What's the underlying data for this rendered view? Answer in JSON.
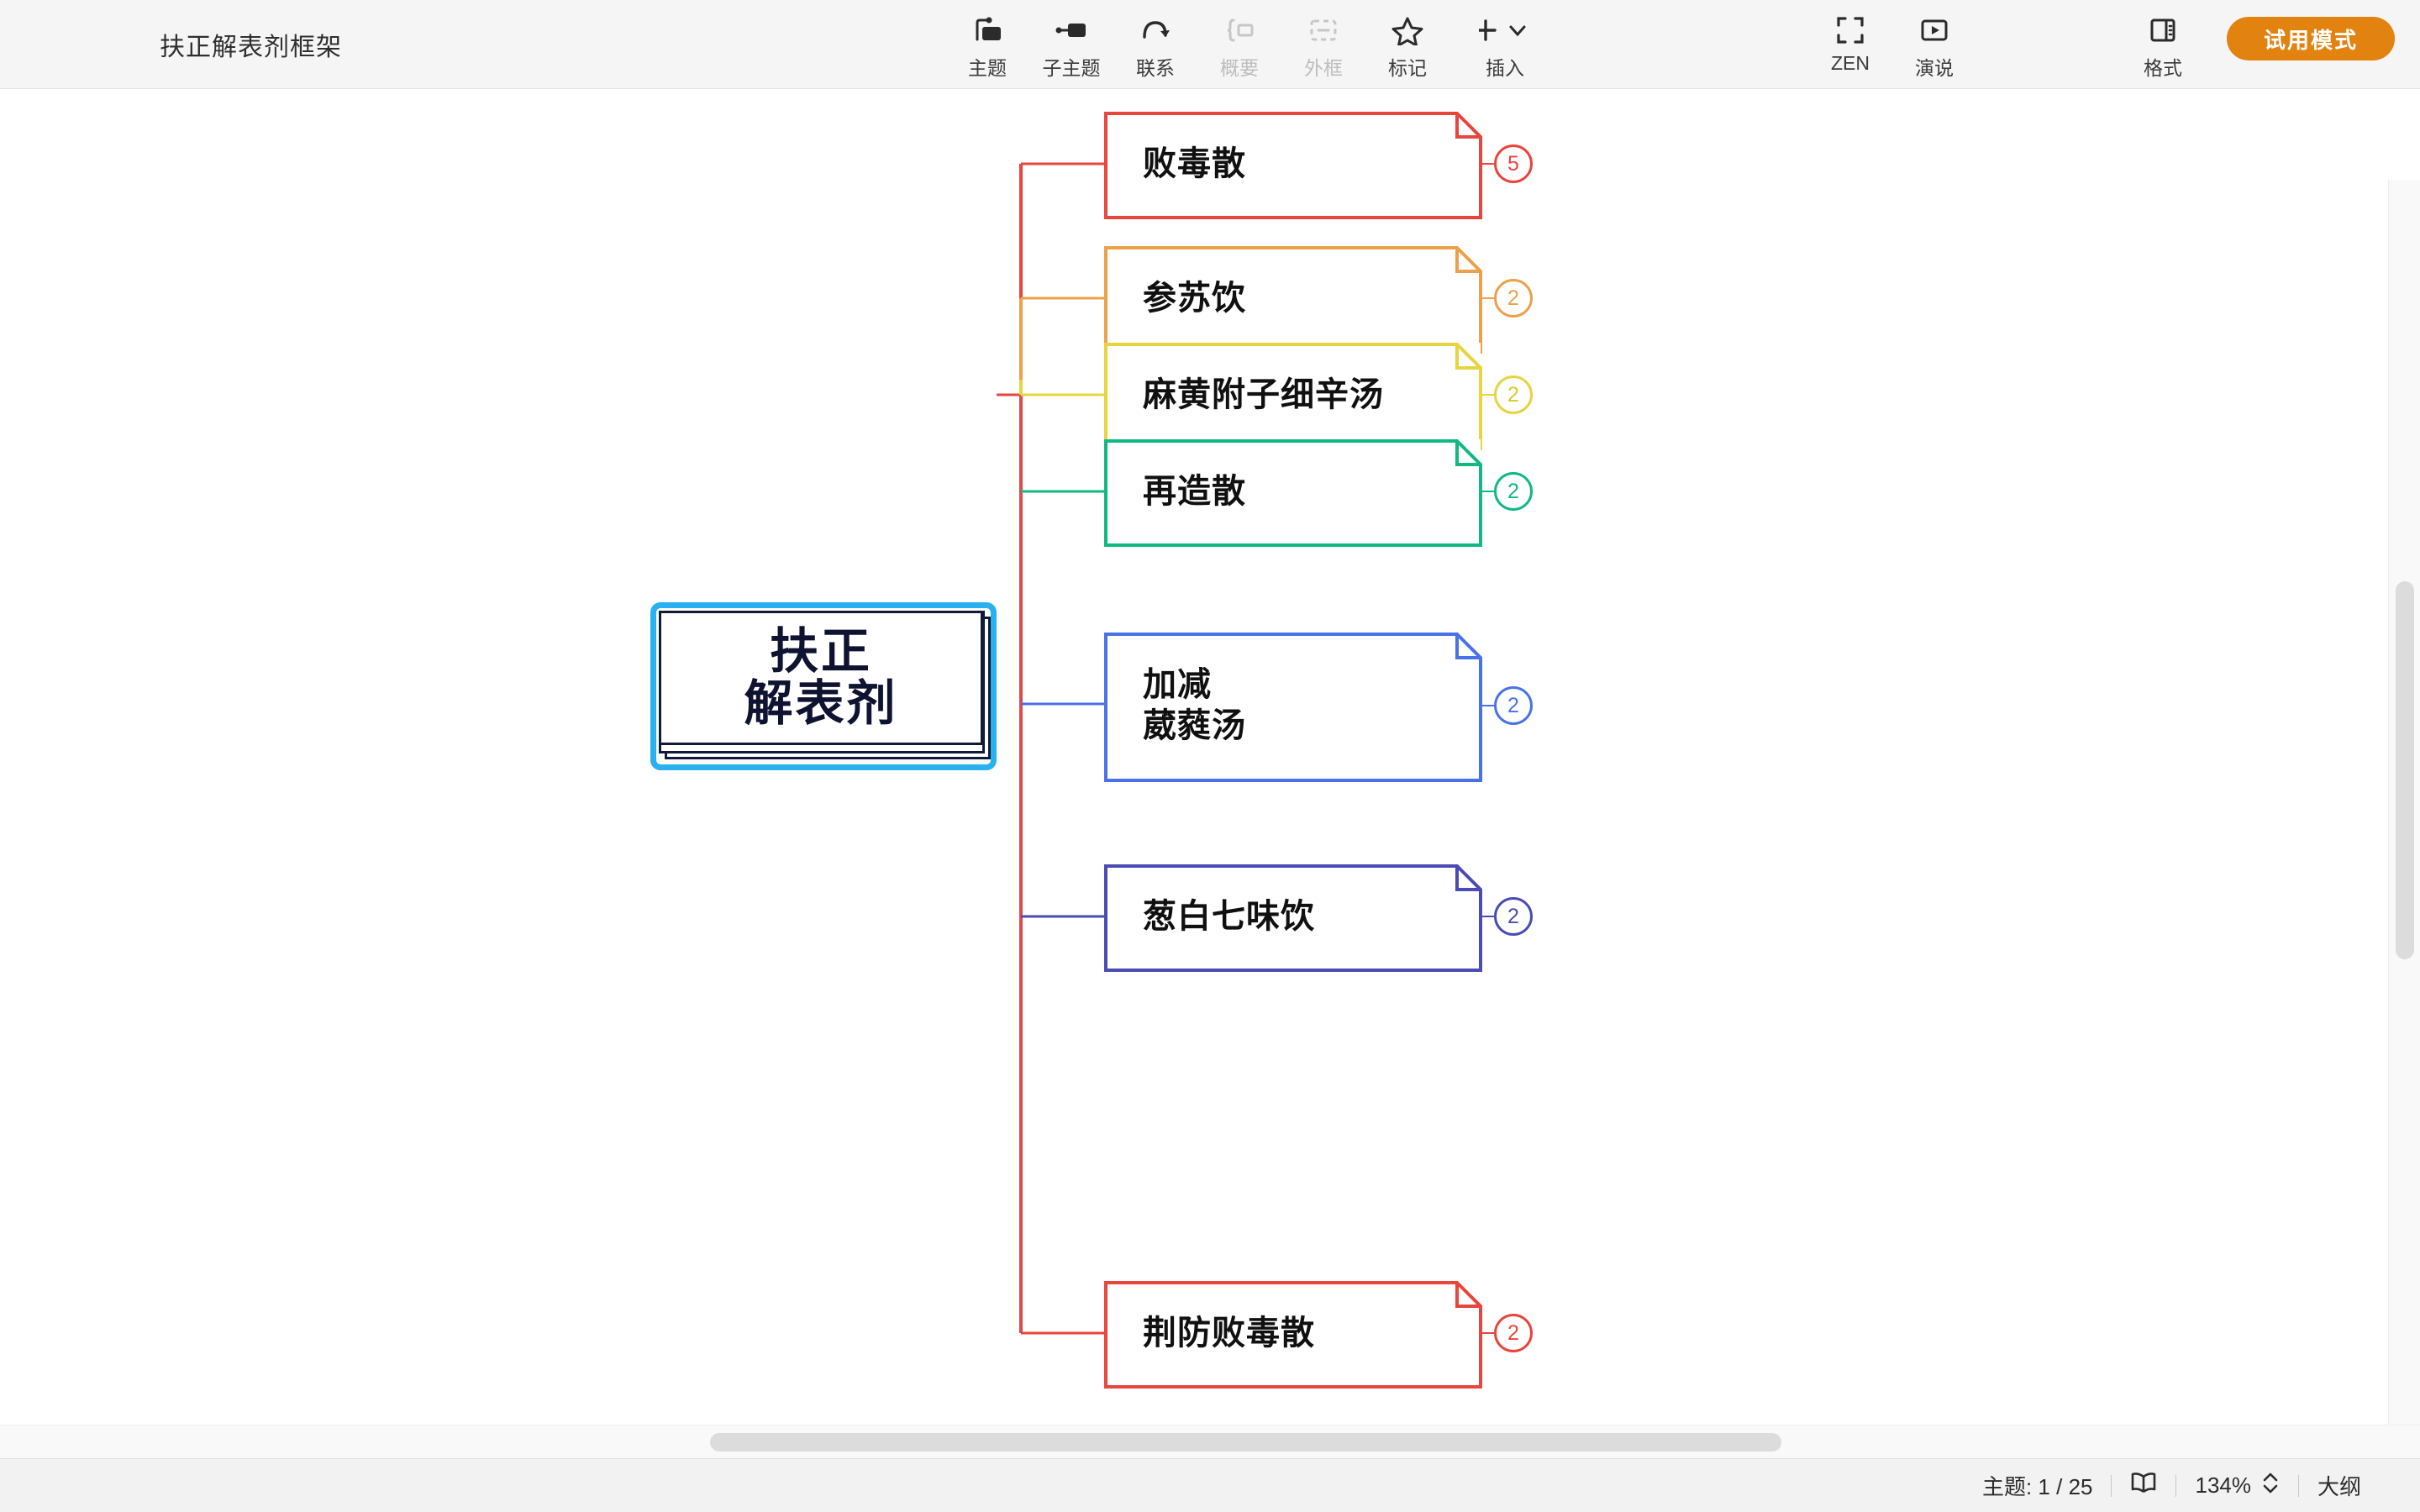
{
  "app": {
    "document_title": "扶正解表剂框架",
    "accent_color": "#e2820f",
    "selection_color": "#29b0f0"
  },
  "toolbar": {
    "items": [
      {
        "label": "主题",
        "icon": "topic-icon",
        "disabled": false
      },
      {
        "label": "子主题",
        "icon": "subtopic-icon",
        "disabled": false
      },
      {
        "label": "联系",
        "icon": "relationship-icon",
        "disabled": false
      },
      {
        "label": "概要",
        "icon": "summary-icon",
        "disabled": true
      },
      {
        "label": "外框",
        "icon": "boundary-icon",
        "disabled": true
      },
      {
        "label": "标记",
        "icon": "star-marker-icon",
        "disabled": false
      },
      {
        "label": "插入",
        "icon": "plus-insert-icon",
        "disabled": false
      }
    ],
    "right_items": [
      {
        "label": "ZEN",
        "icon": "zen-fullscreen-icon"
      },
      {
        "label": "演说",
        "icon": "presentation-play-icon"
      },
      {
        "label": "格式",
        "icon": "format-panel-icon"
      }
    ],
    "trial_button": "试用模式"
  },
  "mindmap": {
    "root": {
      "line1": "扶正",
      "line2": "解表剂",
      "border_color": "#111a38",
      "selected": true
    },
    "nodes": [
      {
        "label_lines": [
          "败毒散"
        ],
        "badge": "5",
        "color": "#e8453c"
      },
      {
        "label_lines": [
          "参苏饮"
        ],
        "badge": "2",
        "color": "#eda04a"
      },
      {
        "label_lines": [
          "麻黄附子细辛汤"
        ],
        "badge": "2",
        "color": "#e8d43c"
      },
      {
        "label_lines": [
          "再造散"
        ],
        "badge": "2",
        "color": "#10b981"
      },
      {
        "label_lines": [
          "加减",
          "葳蕤汤"
        ],
        "badge": "2",
        "color": "#4a72e8"
      },
      {
        "label_lines": [
          "葱白七味饮"
        ],
        "badge": "2",
        "color": "#4b4bb5"
      },
      {
        "label_lines": [
          "荆防败毒散"
        ],
        "badge": "2",
        "color": "#e8453c"
      }
    ]
  },
  "statusbar": {
    "topic_count": "主题: 1 / 25",
    "map_icon": "map-book-icon",
    "zoom_level": "134%",
    "zoom_stepper_icon": "chevron-up-down-icon",
    "outline_label": "大纲"
  }
}
